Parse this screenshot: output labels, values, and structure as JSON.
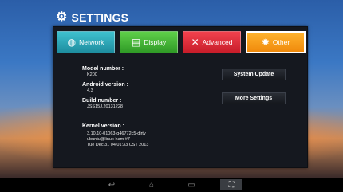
{
  "header": {
    "title": "SETTINGS",
    "icon": "gear-icon"
  },
  "tabs": [
    {
      "label": "Network",
      "icon": "globe-icon",
      "color": "#2aa7b8"
    },
    {
      "label": "Display",
      "icon": "display-icon",
      "color": "#45b535"
    },
    {
      "label": "Advanced",
      "icon": "tools-icon",
      "color": "#e0303c"
    },
    {
      "label": "Other",
      "icon": "gear-icon",
      "color": "#f7a020",
      "selected": true
    }
  ],
  "info": {
    "model_label": "Model number :",
    "model_value": "K200",
    "android_label": "Android version :",
    "android_value": "4.3",
    "build_label": "Build number :",
    "build_value": "JSS15J.20131228",
    "kernel_label": "Kernel version :",
    "kernel_line1": "3.10.10-01063-g46772c5-dirty",
    "kernel_line2": "ubuntu@linux-ham #7",
    "kernel_line3": "Tue Dec 31 04:01:33 CST 2013"
  },
  "buttons": {
    "system_update": "System Update",
    "more_settings": "More Settings"
  },
  "navbar": {
    "icons": [
      "back-icon",
      "home-icon",
      "recents-icon",
      "screenshot-icon"
    ]
  }
}
